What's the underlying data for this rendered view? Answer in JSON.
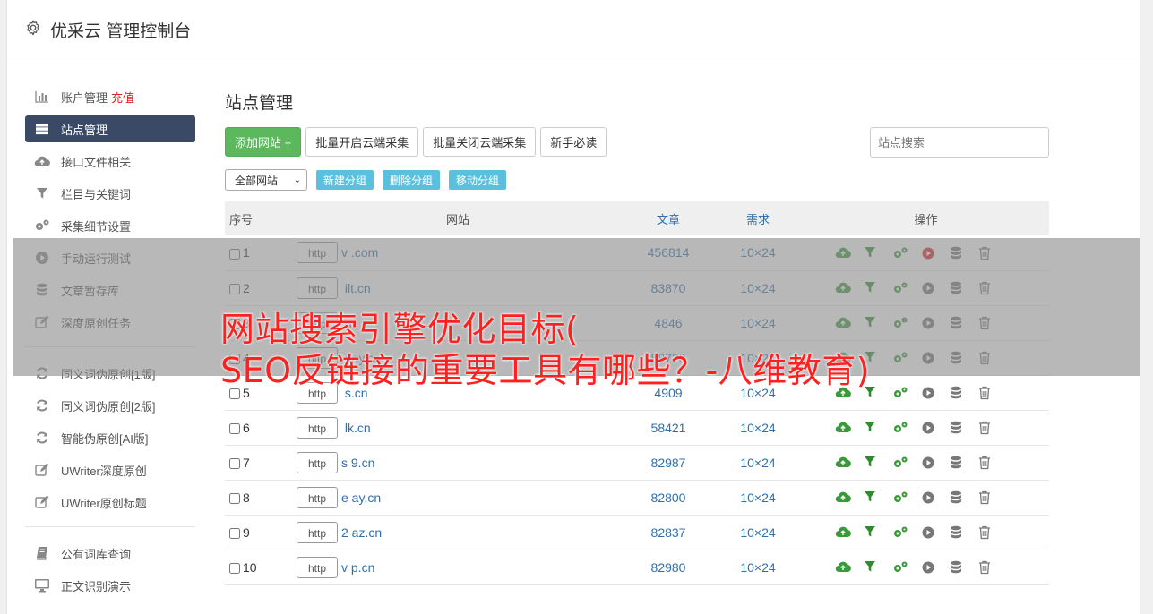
{
  "header": {
    "title": "优采云 管理控制台"
  },
  "sidebar": {
    "group1": [
      {
        "label": "账户管理",
        "badge": "充值",
        "icon": "bar-chart-icon"
      },
      {
        "label": "站点管理",
        "icon": "server-icon",
        "active": true
      },
      {
        "label": "接口文件相关",
        "icon": "cloud-upload-icon"
      },
      {
        "label": "栏目与关键词",
        "icon": "filter-icon"
      },
      {
        "label": "采集细节设置",
        "icon": "gears-icon"
      },
      {
        "label": "手动运行测试",
        "icon": "play-circle-icon"
      },
      {
        "label": "文章暂存库",
        "icon": "database-icon"
      },
      {
        "label": "深度原创任务",
        "icon": "edit-icon"
      }
    ],
    "group2": [
      {
        "label": "同义词伪原创[1版]",
        "icon": "refresh-icon"
      },
      {
        "label": "同义词伪原创[2版]",
        "icon": "refresh-icon"
      },
      {
        "label": "智能伪原创[AI版]",
        "icon": "refresh-icon"
      },
      {
        "label": "UWriter深度原创",
        "icon": "edit-icon"
      },
      {
        "label": "UWriter原创标题",
        "icon": "edit-icon"
      }
    ],
    "group3": [
      {
        "label": "公有词库查询",
        "icon": "book-icon"
      },
      {
        "label": "正文识别演示",
        "icon": "monitor-icon"
      }
    ]
  },
  "main": {
    "title": "站点管理",
    "buttons": {
      "add": "添加网站 +",
      "enable": "批量开启云端采集",
      "disable": "批量关闭云端采集",
      "guide": "新手必读"
    },
    "search_placeholder": "站点搜索",
    "group_select": "全部网站",
    "group_buttons": {
      "new": "新建分组",
      "delete": "删除分组",
      "move": "移动分组"
    },
    "columns": {
      "no": "序号",
      "site": "网站",
      "articles": "文章",
      "demand": "需求",
      "ops": "操作"
    },
    "rows": [
      {
        "no": "1",
        "proto": "http",
        "site": "v          .com",
        "articles": "456814",
        "demand": "10×24"
      },
      {
        "no": "2",
        "proto": "http",
        "site": "    ilt.cn",
        "articles": "83870",
        "demand": "10×24"
      },
      {
        "no": "3",
        "proto": "http",
        "site": "        n",
        "articles": "4846",
        "demand": "10×24"
      },
      {
        "no": "4",
        "proto": "http",
        "site": "      pay.cn",
        "articles": "58728",
        "demand": "10×24"
      },
      {
        "no": "5",
        "proto": "http",
        "site": "      s.cn",
        "articles": "4909",
        "demand": "10×24"
      },
      {
        "no": "6",
        "proto": "http",
        "site": "    lk.cn",
        "articles": "58421",
        "demand": "10×24"
      },
      {
        "no": "7",
        "proto": "http",
        "site": "s    9.cn",
        "articles": "82987",
        "demand": "10×24"
      },
      {
        "no": "8",
        "proto": "http",
        "site": "e     ay.cn",
        "articles": "82800",
        "demand": "10×24"
      },
      {
        "no": "9",
        "proto": "http",
        "site": "2     az.cn",
        "articles": "82837",
        "demand": "10×24"
      },
      {
        "no": "10",
        "proto": "http",
        "site": "v    p.cn",
        "articles": "82980",
        "demand": "10×24"
      }
    ]
  },
  "overlay": {
    "line1": "网站搜索引擎优化目标(",
    "line2": "SEO反链接的重要工具有哪些？-八维教育)"
  },
  "colors": {
    "accent": "#3a4a66",
    "green": "#5cb85c",
    "info": "#5bc0de",
    "link": "#2f6fab",
    "overlay_text": "#ff2020"
  }
}
